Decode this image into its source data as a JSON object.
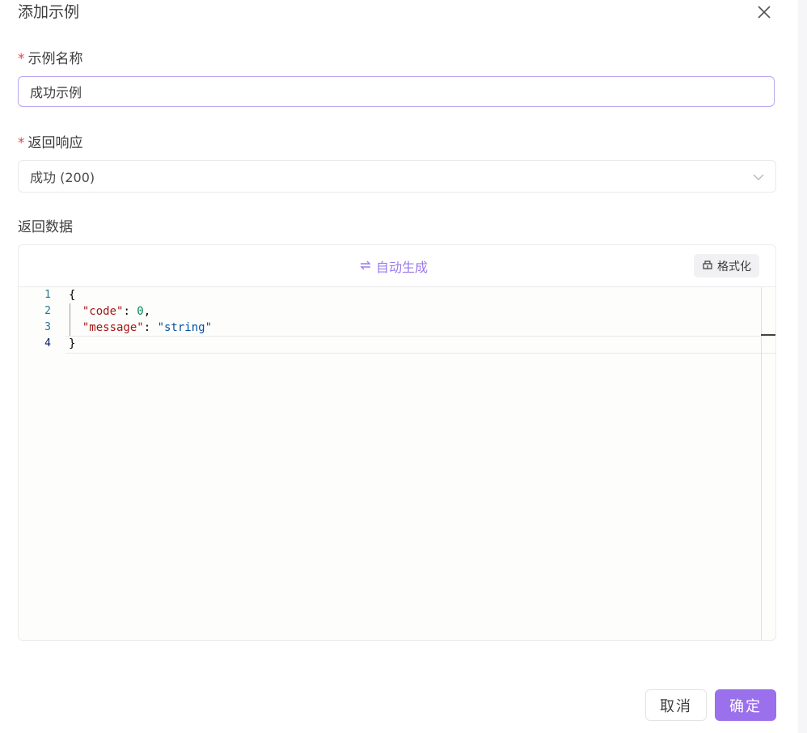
{
  "dialog": {
    "title": "添加示例",
    "close_icon": "close-icon"
  },
  "fields": {
    "example_name": {
      "label": "示例名称",
      "required_mark": "*",
      "value": "成功示例"
    },
    "response": {
      "label": "返回响应",
      "required_mark": "*",
      "value": "成功 (200)",
      "icon": "chevron-down-icon"
    },
    "data": {
      "label": "返回数据",
      "auto_generate_label": "自动生成",
      "auto_generate_icon": "swap-icon",
      "format_label": "格式化",
      "format_icon": "brush-icon"
    }
  },
  "editor": {
    "line_numbers": [
      "1",
      "2",
      "3",
      "4"
    ],
    "lines": {
      "open": "{",
      "code_key": "\"code\"",
      "code_value": "0",
      "message_key": "\"message\"",
      "message_value": "\"string\"",
      "close": "}"
    }
  },
  "footer": {
    "cancel_label": "取消",
    "confirm_label": "确定"
  },
  "colors": {
    "accent": "#9b70ec",
    "required": "#e5484d",
    "line_number": "#237893",
    "json_key": "#a31515",
    "json_number": "#098658",
    "json_string": "#0451a5"
  }
}
